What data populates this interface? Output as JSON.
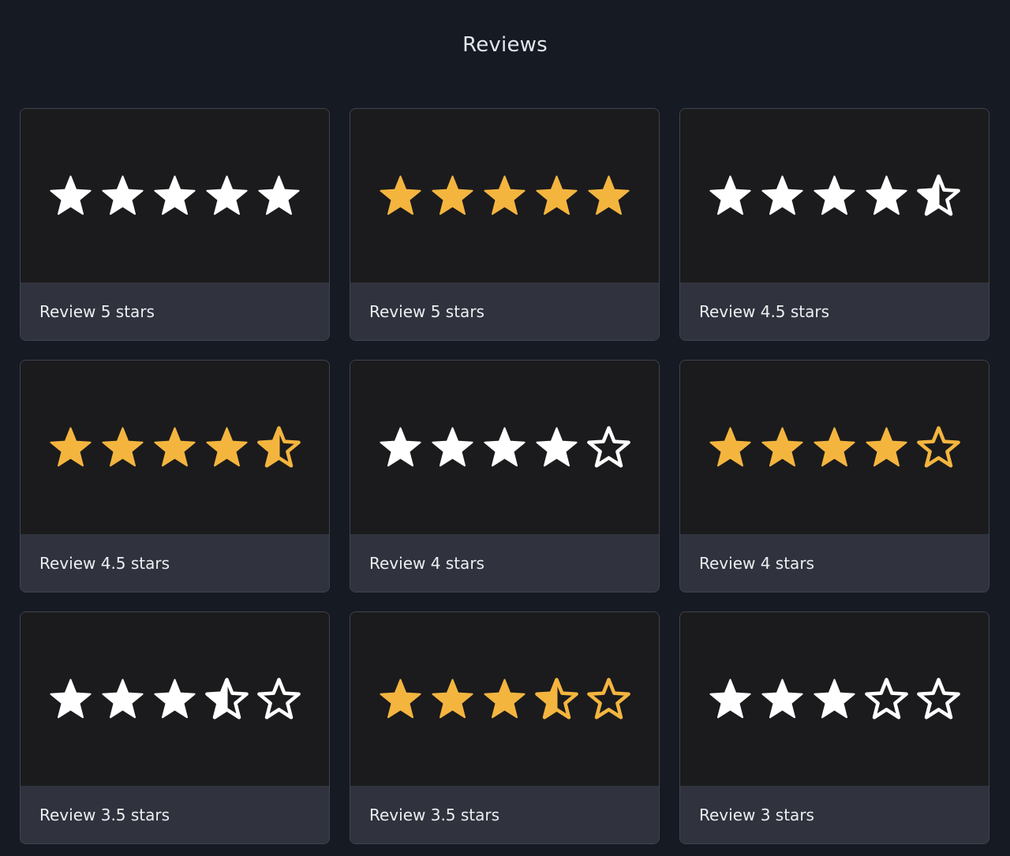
{
  "page": {
    "title": "Reviews"
  },
  "colors": {
    "white": "#ffffff",
    "gold": "#f4b53f",
    "background": "#161a23",
    "caption_bg": "#30333d",
    "media_bg": "#1b1b1d"
  },
  "reviews": [
    {
      "label": "Review 5 stars",
      "rating": 5,
      "max": 5,
      "star_color": "white"
    },
    {
      "label": "Review 5 stars",
      "rating": 5,
      "max": 5,
      "star_color": "gold"
    },
    {
      "label": "Review 4.5 stars",
      "rating": 4.5,
      "max": 5,
      "star_color": "white"
    },
    {
      "label": "Review 4.5 stars",
      "rating": 4.5,
      "max": 5,
      "star_color": "gold"
    },
    {
      "label": "Review 4 stars",
      "rating": 4,
      "max": 5,
      "star_color": "white"
    },
    {
      "label": "Review 4 stars",
      "rating": 4,
      "max": 5,
      "star_color": "gold"
    },
    {
      "label": "Review 3.5 stars",
      "rating": 3.5,
      "max": 5,
      "star_color": "white"
    },
    {
      "label": "Review 3.5 stars",
      "rating": 3.5,
      "max": 5,
      "star_color": "gold"
    },
    {
      "label": "Review 3 stars",
      "rating": 3,
      "max": 5,
      "star_color": "white"
    }
  ]
}
